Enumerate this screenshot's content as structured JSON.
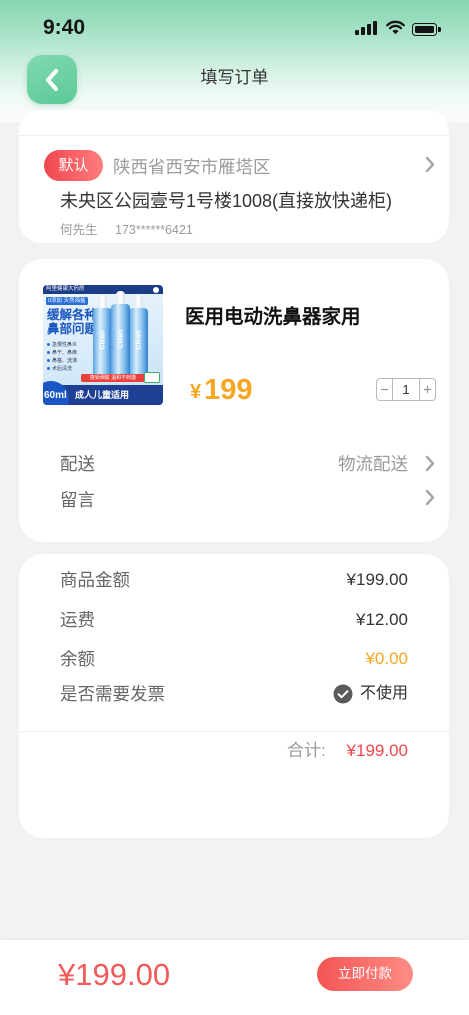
{
  "status_bar": {
    "time": "9:40"
  },
  "header": {
    "title": "填写订单"
  },
  "address": {
    "default_badge": "默认",
    "region": "陕西省西安市雁塔区",
    "detail": "未央区公园壹号1号楼1008(直接放快递柜)",
    "recipient": "何先生",
    "phone": "173******6421"
  },
  "product": {
    "title": "医用电动洗鼻器家用",
    "currency": "¥",
    "price": "199",
    "quantity": "1",
    "image": {
      "store": "阿里健康大药房",
      "tag": "0添加 天然海盐",
      "headline_1": "缓解各种",
      "headline_2": "鼻部问题",
      "features": [
        "急慢性鼻炎",
        "鼻干、鼻痒",
        "鼻塞、流涕",
        "术后清洗"
      ],
      "bottle_label": "Clean",
      "ribbon": "感受细腻 温和不刺激",
      "banner": "成人儿童适用",
      "volume": "60ml"
    }
  },
  "order_options": {
    "delivery_label": "配送",
    "delivery_value": "物流配送",
    "message_label": "留言"
  },
  "summary": {
    "rows": [
      {
        "label": "商品金额",
        "value": "¥199.00"
      },
      {
        "label": "运费",
        "value": "¥12.00"
      },
      {
        "label": "余额",
        "value": "¥0.00"
      }
    ],
    "invoice_label": "是否需要发票",
    "invoice_value": "不使用",
    "total_label": "合计:",
    "total_value": "¥199.00"
  },
  "footer": {
    "total": "¥199.00",
    "pay_button": "立即付款"
  },
  "icons": {
    "back": "chevron-left-icon",
    "row_more": "chevron-right-icon",
    "invoice_status": "check-circle-icon",
    "signal": "cellular-signal-icon",
    "wifi": "wifi-icon",
    "battery": "battery-icon",
    "decrease": "minus-icon",
    "increase": "plus-icon"
  },
  "colors": {
    "brand_green": "#5cc998",
    "accent_red": "#f0474d",
    "price_orange": "#f5a623",
    "badge_red": "#f0464f",
    "page_background": "#f2f2f2"
  }
}
